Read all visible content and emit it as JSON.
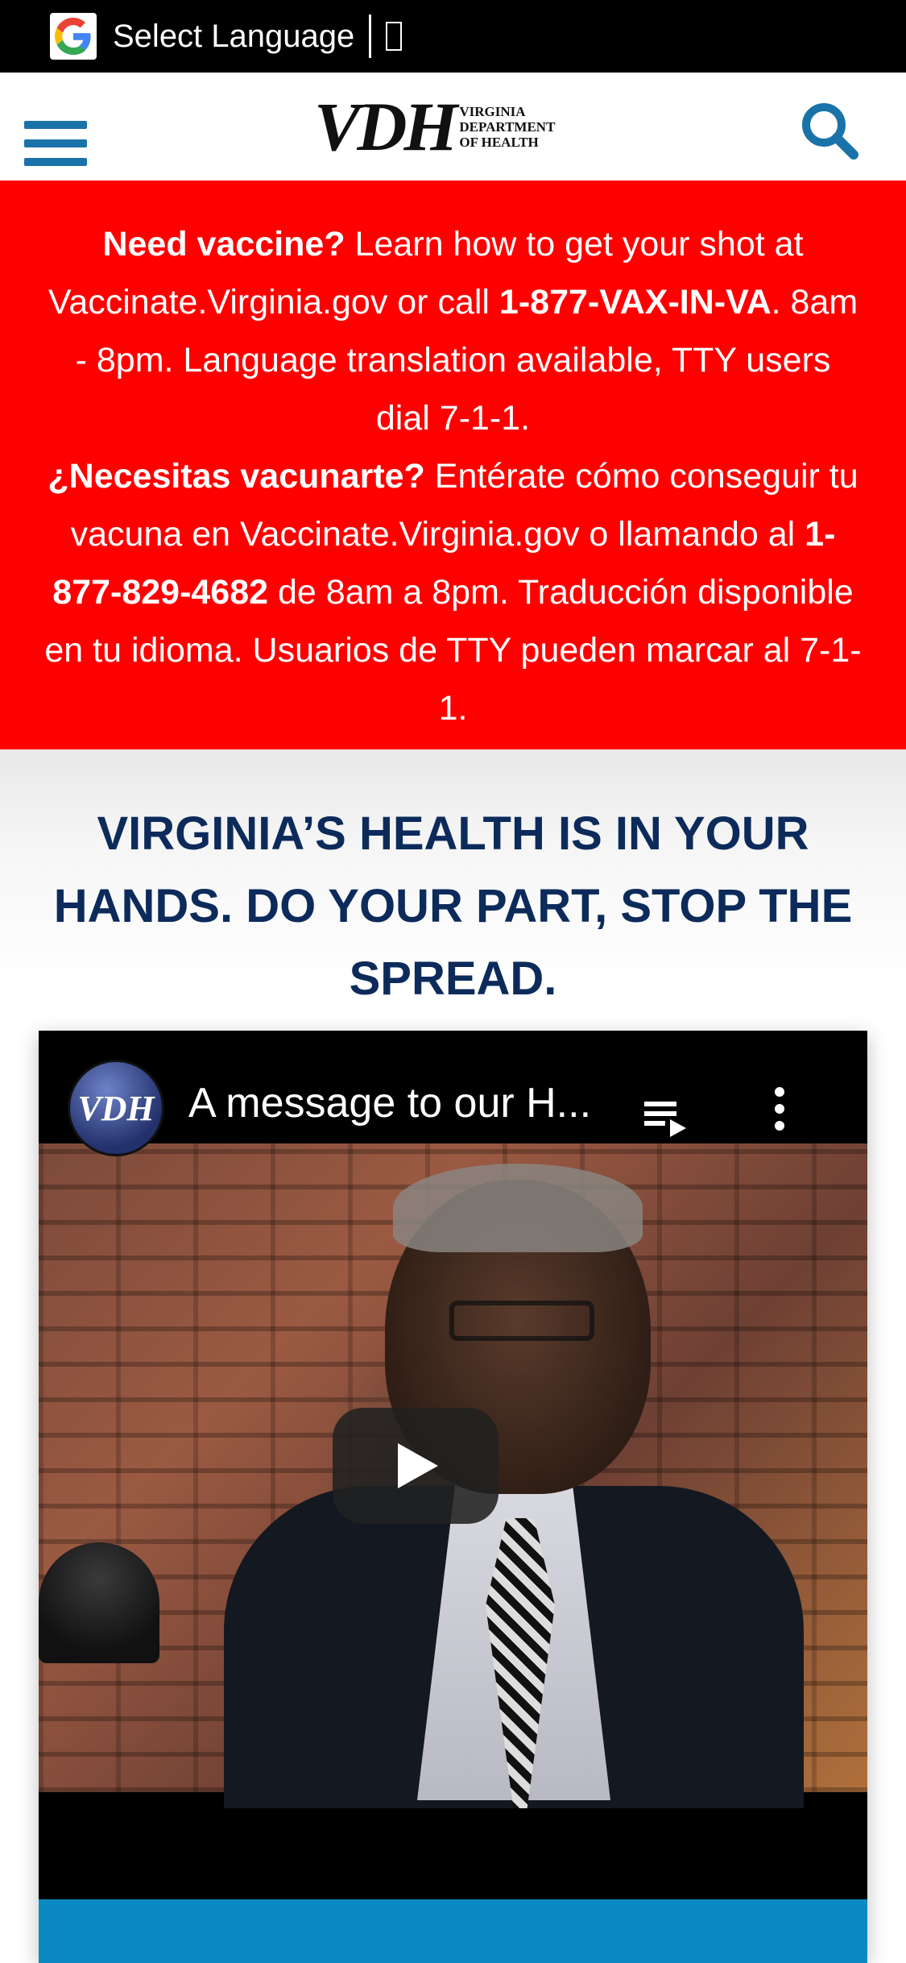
{
  "translate": {
    "label": "Select Language",
    "caret_glyph": ""
  },
  "header": {
    "logo_mark": "VDH",
    "logo_sub_line1": "VIRGINIA",
    "logo_sub_line2": "DEPARTMENT",
    "logo_sub_line3": "OF HEALTH"
  },
  "alert": {
    "en_bold": "Need vaccine?",
    "en_text1": " Learn how to get your shot at Vaccinate.Virginia.gov or call ",
    "en_phone": "1-877-VAX-IN-VA",
    "en_text2": ". 8am - 8pm. Language translation available, TTY users dial 7-1-1.",
    "es_bold": "¿Necesitas vacunarte?",
    "es_text1": " Entérate cómo conseguir tu vacuna en Vaccinate.Virginia.gov o llamando al ",
    "es_phone": "1-877-829-4682",
    "es_text2": " de 8am a 8pm. Traducción disponible en tu idioma. Usuarios de TTY pueden marcar al 7-1-1."
  },
  "main": {
    "headline": "VIRGINIA’S HEALTH IS IN YOUR HANDS. DO YOUR PART, STOP THE SPREAD."
  },
  "video": {
    "channel": "VDH",
    "title": "A message to our H..."
  },
  "colors": {
    "alert_bg": "#ff0000",
    "headline": "#0c2b5b",
    "accent_blue": "#0a8ac2"
  }
}
